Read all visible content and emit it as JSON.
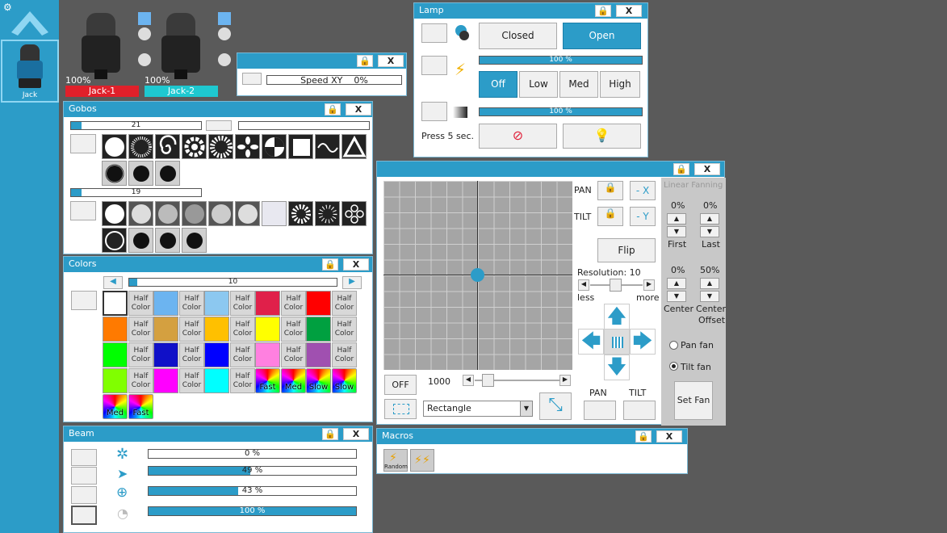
{
  "sidebar": {
    "fixture_label": "Jack"
  },
  "fixtures": [
    {
      "name": "Jack-1",
      "percent": "100%",
      "color": "#e0202a"
    },
    {
      "name": "Jack-2",
      "percent": "100%",
      "color": "#1ec8d0"
    }
  ],
  "speed_panel": {
    "label": "Speed XY",
    "value": "0%"
  },
  "lamp": {
    "title": "Lamp",
    "closed_label": "Closed",
    "open_label": "Open",
    "bar1": "100 %",
    "off_label": "Off",
    "low_label": "Low",
    "med_label": "Med",
    "high_label": "High",
    "bar2": "100 %",
    "press_label": "Press 5 sec."
  },
  "gobos": {
    "title": "Gobos",
    "wheel1_value": "21",
    "wheel2_value": "19"
  },
  "colors": {
    "title": "Colors",
    "value": "10",
    "half_label_1": "Half",
    "half_label_2": "Color",
    "fast": "Fast",
    "med": "Med",
    "slow": "Slow",
    "swatches": [
      "#ffffff",
      "#6cb4f0",
      "#8cc8f0",
      "#e0204a",
      "#ff0000",
      "#ff7a00",
      "#d4a040",
      "#ffc000",
      "#ffff00",
      "#00a040",
      "#00ff00",
      "#1010c8",
      "#0000ff",
      "#ff80e0",
      "#a050b0",
      "#80ff00",
      "#ff00ff",
      "#00ffff"
    ]
  },
  "beam": {
    "title": "Beam",
    "rows": [
      "0 %",
      "49 %",
      "43 %",
      "100 %"
    ],
    "fills": [
      0,
      0.49,
      0.43,
      1
    ]
  },
  "macros": {
    "title": "Macros",
    "random_label": "Random"
  },
  "position": {
    "pan_label": "PAN",
    "tilt_label": "TILT",
    "minus_x": "- X",
    "minus_y": "- Y",
    "flip_label": "Flip",
    "resolution_label": "Resolution: 10",
    "less_label": "less",
    "more_label": "more",
    "off_label": "OFF",
    "speed_value": "1000",
    "shape_value": "Rectangle",
    "pan_bottom": "PAN",
    "tilt_bottom": "TILT"
  },
  "fanning": {
    "title": "Linear Fanning",
    "first_value": "0%",
    "last_value": "0%",
    "first_label": "First",
    "last_label": "Last",
    "center_value": "0%",
    "offset_value": "50%",
    "center_label": "Center",
    "center_offset_label_1": "Center",
    "center_offset_label_2": "Offset",
    "pan_fan": "Pan fan",
    "tilt_fan": "Tilt fan",
    "set_fan": "Set Fan"
  }
}
